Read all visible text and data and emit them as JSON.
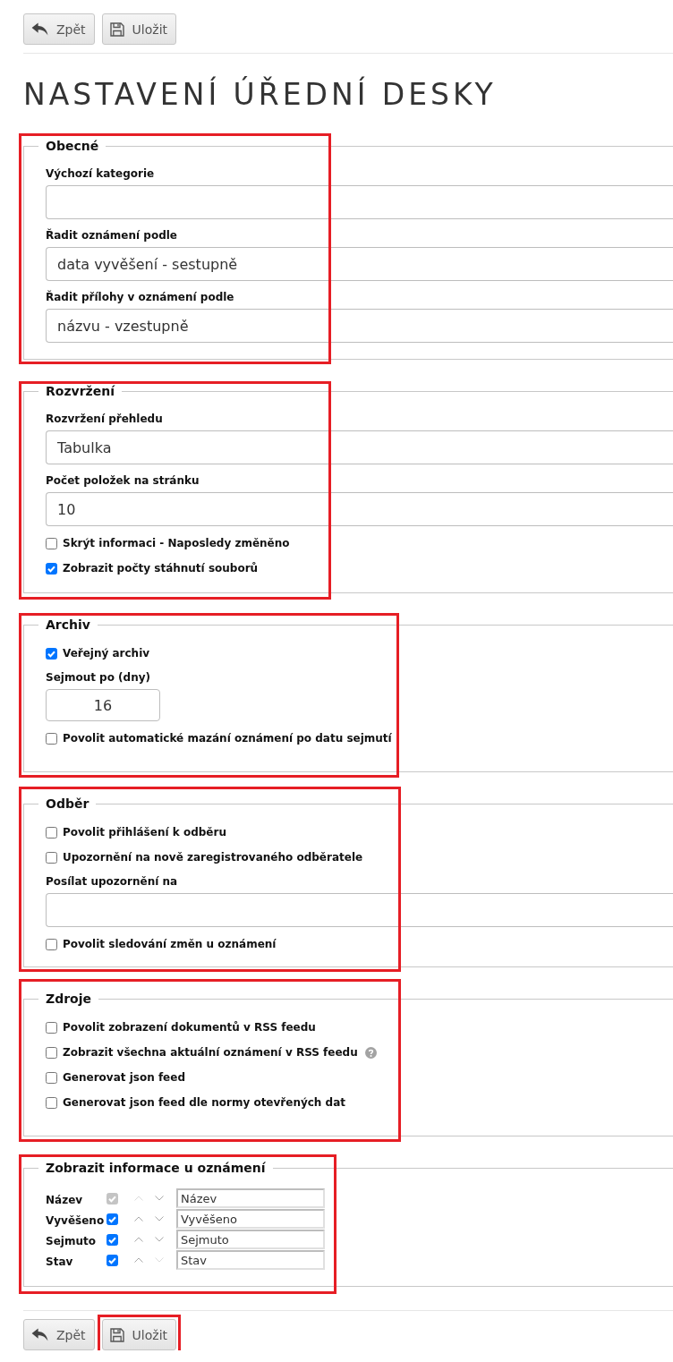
{
  "top_toolbar": {
    "buttons": [
      {
        "kind": "back",
        "label": "Zpět",
        "highlighted": false
      },
      {
        "kind": "save",
        "label": "Uložit",
        "highlighted": false
      }
    ]
  },
  "title": "NASTAVENÍ ÚŘEDNÍ DESKY",
  "sections": [
    {
      "title": "Obecné",
      "highlighted": true,
      "items": [
        {
          "kind": "field",
          "label": "Výchozí kategorie"
        },
        {
          "kind": "field",
          "label": "Řadit oznámení podle",
          "value": "data vyvěšení - sestupně"
        },
        {
          "kind": "field",
          "label": "Řadit přílohy v oznámení podle",
          "value": "názvu - vzestupně"
        }
      ]
    },
    {
      "title": "Rozvržení",
      "highlighted": true,
      "items": [
        {
          "kind": "field",
          "label": "Rozvržení přehledu",
          "value": "Tabulka"
        },
        {
          "kind": "field",
          "label": "Počet položek na stránku",
          "value": "10"
        },
        {
          "kind": "checkbox",
          "label": "Skrýt informaci - Naposledy změněno",
          "checked": false,
          "help": false
        },
        {
          "kind": "checkbox",
          "label": "Zobrazit počty stáhnutí souborů",
          "checked": true,
          "help": false
        }
      ]
    },
    {
      "title": "Archiv",
      "highlighted": true,
      "items": [
        {
          "kind": "checkbox",
          "label": "Veřejný archiv",
          "checked": true,
          "help": false
        },
        {
          "kind": "number",
          "label": "Sejmout po (dny)",
          "value": "16"
        },
        {
          "kind": "checkbox",
          "label": "Povolit automatické mazání oznámení po datu sejmutí",
          "checked": false,
          "help": false
        }
      ]
    },
    {
      "title": "Odběr",
      "highlighted": true,
      "items": [
        {
          "kind": "checkbox",
          "label": "Povolit přihlášení k odběru",
          "checked": false,
          "help": false
        },
        {
          "kind": "checkbox",
          "label": "Upozornění na nově zaregistrovaného odběratele",
          "checked": false,
          "help": false
        },
        {
          "kind": "field",
          "label": "Posílat upozornění na"
        },
        {
          "kind": "checkbox",
          "label": "Povolit sledování změn u oznámení",
          "checked": false,
          "help": false
        }
      ]
    },
    {
      "title": "Zdroje",
      "highlighted": true,
      "items": [
        {
          "kind": "checkbox",
          "label": "Povolit zobrazení dokumentů v RSS feedu",
          "checked": false,
          "help": false
        },
        {
          "kind": "checkbox",
          "label": "Zobrazit všechna aktuální oznámení v RSS feedu",
          "checked": false,
          "help": true
        },
        {
          "kind": "checkbox",
          "label": "Generovat json feed",
          "checked": false,
          "help": false
        },
        {
          "kind": "checkbox",
          "label": "Generovat json feed dle normy otevřených dat",
          "checked": false,
          "help": false
        }
      ]
    },
    {
      "title": "Zobrazit informace u oznámení",
      "highlighted": true,
      "items": [
        {
          "kind": "column",
          "label": "Název",
          "checked": true,
          "disabled": true,
          "up_disabled": true,
          "down_disabled": false,
          "value": "Název"
        },
        {
          "kind": "column",
          "label": "Vyvěšeno",
          "checked": true,
          "disabled": false,
          "up_disabled": false,
          "down_disabled": false,
          "value": "Vyvěšeno"
        },
        {
          "kind": "column",
          "label": "Sejmuto",
          "checked": true,
          "disabled": false,
          "up_disabled": false,
          "down_disabled": false,
          "value": "Sejmuto"
        },
        {
          "kind": "column",
          "label": "Stav",
          "checked": true,
          "disabled": false,
          "up_disabled": false,
          "down_disabled": true,
          "value": "Stav"
        }
      ]
    }
  ],
  "bottom_toolbar": {
    "buttons": [
      {
        "kind": "back",
        "label": "Zpět",
        "highlighted": false
      },
      {
        "kind": "save",
        "label": "Uložit",
        "highlighted": true
      }
    ]
  }
}
